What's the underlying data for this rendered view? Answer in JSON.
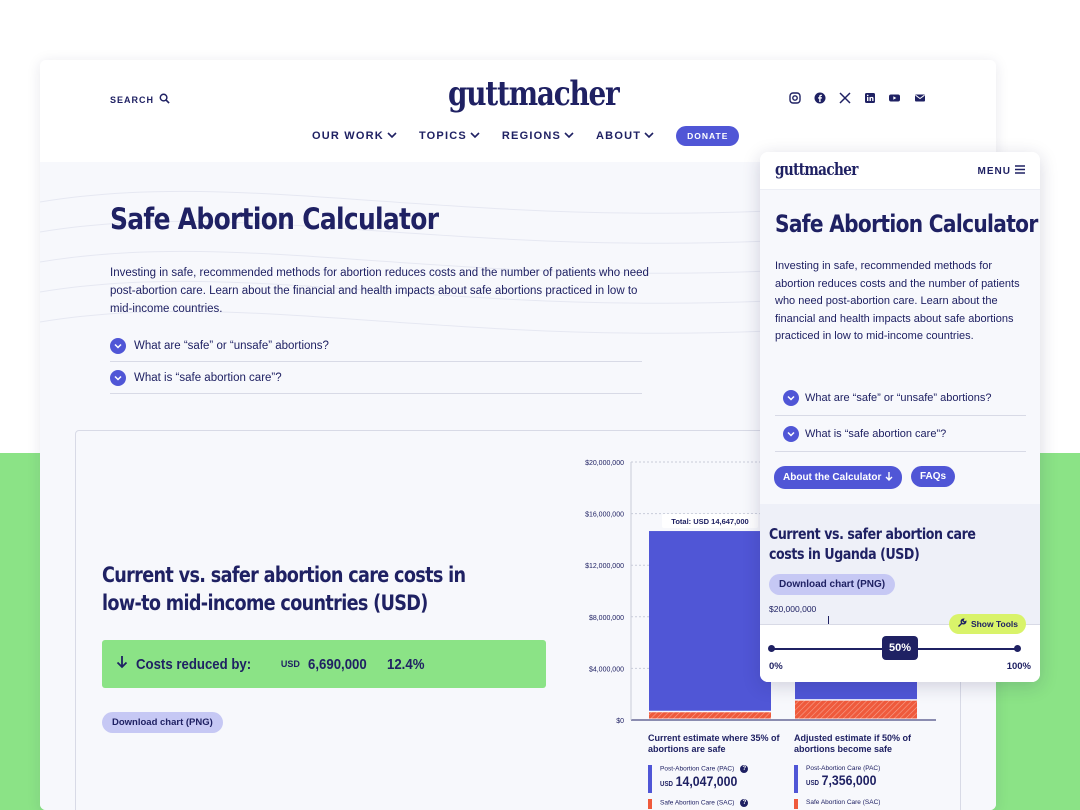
{
  "brand": {
    "logo": "guttmacher"
  },
  "header": {
    "search_label": "SEARCH",
    "nav": [
      {
        "label": "OUR WORK"
      },
      {
        "label": "TOPICS"
      },
      {
        "label": "REGIONS"
      },
      {
        "label": "ABOUT"
      }
    ],
    "donate_label": "DONATE",
    "socials": [
      "instagram-icon",
      "facebook-icon",
      "x-icon",
      "linkedin-icon",
      "youtube-icon",
      "email-icon"
    ]
  },
  "hero": {
    "title": "Safe Abortion Calculator",
    "intro": "Investing in safe, recommended methods for abortion reduces costs and the number of patients who need post-abortion care. Learn about the financial and health impacts about safe abortions practiced in low to mid-income countries.",
    "faqs": [
      {
        "label": "What are “safe” or “unsafe” abortions?"
      },
      {
        "label": "What is “safe abortion care”?"
      }
    ]
  },
  "calculator": {
    "title": "Current vs. safer abortion care costs in low-to mid-income countries (USD)",
    "reduction_label": "Costs reduced by:",
    "reduction_currency": "USD",
    "reduction_value": "6,690,000",
    "reduction_percent": "12.4%",
    "download_label": "Download chart (PNG)"
  },
  "chart_data": {
    "type": "bar",
    "stacked": true,
    "y_ticks": [
      "$0",
      "$4,000,000",
      "$8,000,000",
      "$12,000,000",
      "$16,000,000",
      "$20,000,000"
    ],
    "ylim": [
      0,
      20000000
    ],
    "categories": [
      "Current estimate where 35% of abortions are safe",
      "Adjusted estimate if 50% of abortions become safe"
    ],
    "series": [
      {
        "name": "Post-Abortion Care (PAC)",
        "color": "#5056d6",
        "values": [
          14047000,
          7356000
        ]
      },
      {
        "name": "Safe Abortion Care (SAC)",
        "color": "#ef5a3c",
        "values": [
          600000,
          1500000
        ]
      }
    ],
    "total_label": "Total: USD 14,647,000",
    "legend": {
      "col1_caption": "Current estimate where 35% of abortions are safe",
      "col2_caption": "Adjusted estimate if 50% of abortions become safe",
      "pac_label": "Post-Abortion Care (PAC)",
      "sac_label": "Safe Abortion Care (SAC)",
      "currency": "USD",
      "col1_pac_value": "14,047,000",
      "col2_pac_value": "7,356,000"
    }
  },
  "mobile": {
    "logo": "guttmacher",
    "menu_label": "MENU",
    "title": "Safe Abortion Calculator",
    "intro": "Investing in safe, recommended methods for abortion reduces costs and the number of patients who need post-abortion care. Learn about the financial and health impacts about safe abortions practiced in low to mid-income countries.",
    "faqs": [
      {
        "label": "What are “safe” or “unsafe” abortions?"
      },
      {
        "label": "What is “safe abortion care”?"
      }
    ],
    "about_label": "About the Calculator",
    "faqs_label": "FAQs",
    "chart_title": "Current vs. safer abortion care costs in Uganda (USD)",
    "download_label": "Download chart (PNG)",
    "axis_top": "$20,000,000",
    "show_tools_label": "Show Tools",
    "slider": {
      "value": "50%",
      "min_label": "0%",
      "max_label": "100%",
      "fraction": 0.5
    }
  }
}
